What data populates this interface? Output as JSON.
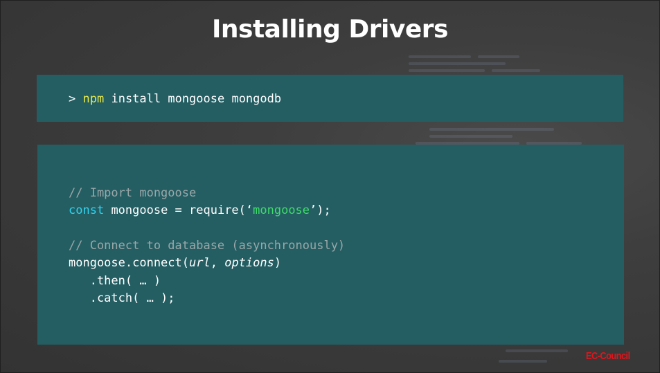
{
  "slide": {
    "title": "Installing Drivers",
    "logo_text": "EC-Council"
  },
  "command": {
    "prompt": ">",
    "tool": "npm",
    "args": "install mongoose mongodb"
  },
  "code": {
    "comment_import": "// Import mongoose",
    "keyword_const": "const",
    "require_left": "mongoose = require(‘",
    "module_name": "mongoose",
    "require_right": "’);",
    "comment_connect": "// Connect to database (asynchronously)",
    "connect_call": "mongoose.connect(",
    "param_url": "url",
    "comma": ", ",
    "param_options": "options",
    "close_paren": ")",
    "then_line": "   .then( … )",
    "catch_line": "   .catch( … );"
  },
  "colors": {
    "panel_background": "#245e63",
    "slide_background": "#3a3a3a",
    "npm_highlight": "#e6e84a",
    "comment": "#9aa7a8",
    "keyword": "#31d3ee",
    "string": "#3fdc6a",
    "logo": "#e3141b"
  }
}
